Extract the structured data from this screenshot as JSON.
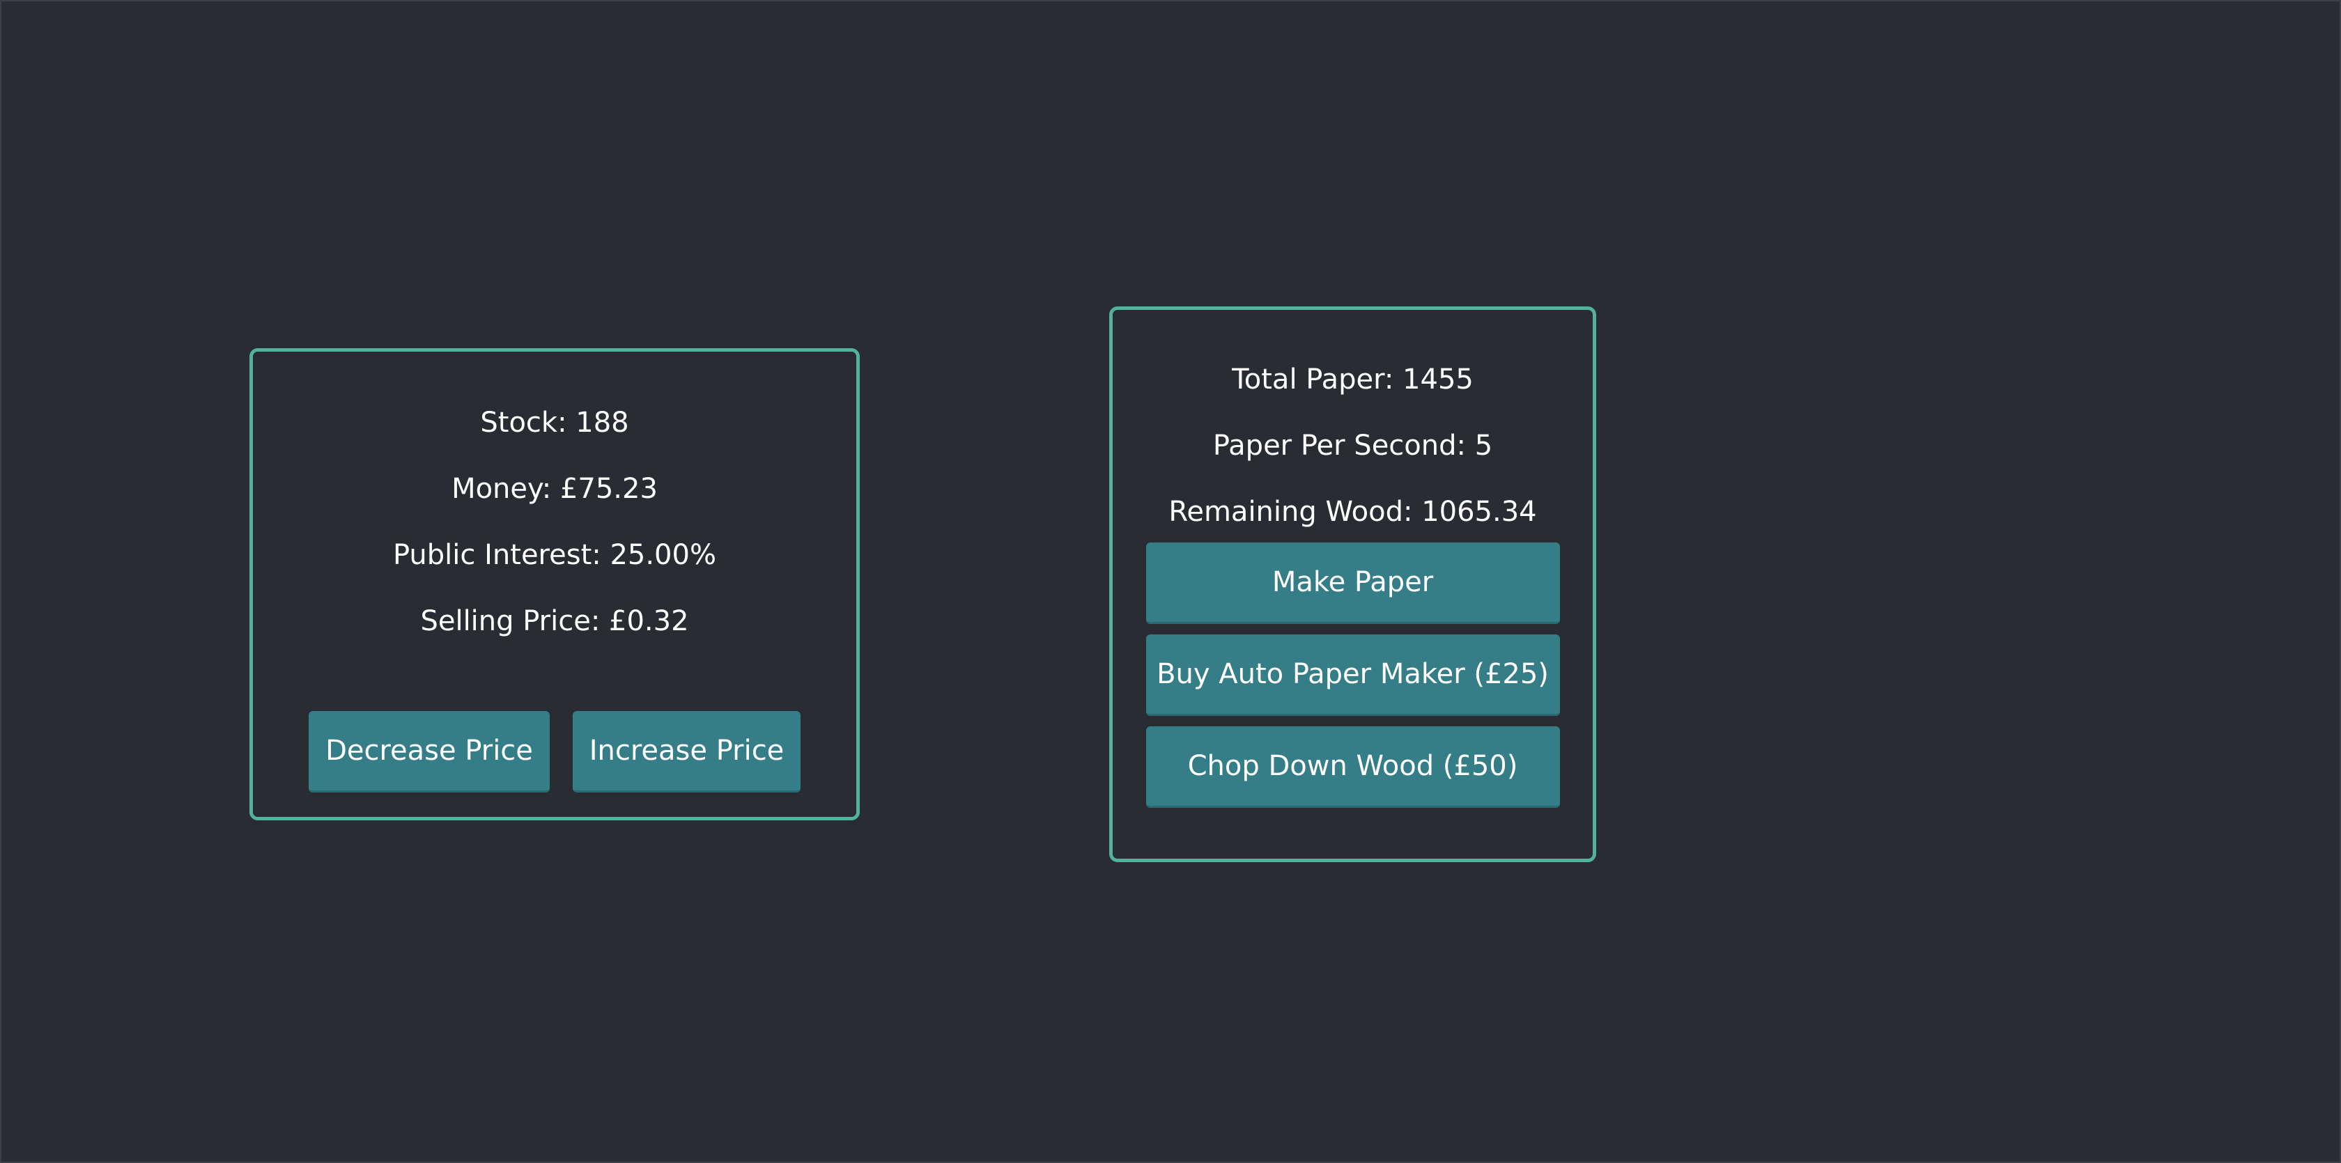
{
  "sales": {
    "stock": "Stock: 188",
    "money": "Money: £75.23",
    "public_interest": "Public Interest: 25.00%",
    "selling_price": "Selling Price: £0.32",
    "decrease_label": "Decrease Price",
    "increase_label": "Increase Price"
  },
  "production": {
    "total_paper": "Total Paper: 1455",
    "paper_per_second": "Paper Per Second: 5",
    "remaining_wood": "Remaining Wood: 1065.34",
    "make_paper_label": "Make Paper",
    "buy_auto_label": "Buy Auto Paper Maker (£25)",
    "chop_wood_label": "Chop Down Wood (£50)"
  },
  "colors": {
    "background": "#292c33",
    "panel_border": "#53b297",
    "button": "#367e87",
    "text": "#ffffff"
  }
}
